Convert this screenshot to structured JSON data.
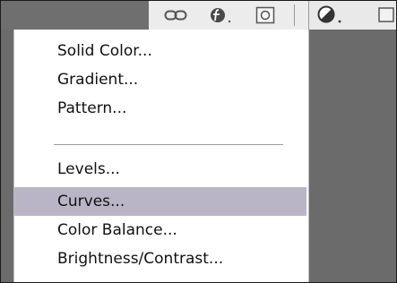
{
  "toolbar": {
    "icons": [
      {
        "name": "link-icon"
      },
      {
        "name": "fx-icon"
      },
      {
        "name": "layer-mask-icon"
      },
      {
        "name": "adjustment-layer-icon"
      },
      {
        "name": "new-layer-icon"
      }
    ]
  },
  "menu": {
    "group1": [
      {
        "label": "Solid Color..."
      },
      {
        "label": "Gradient..."
      },
      {
        "label": "Pattern..."
      }
    ],
    "group2": [
      {
        "label": "Levels..."
      },
      {
        "label": "Curves..."
      },
      {
        "label": "Color Balance..."
      },
      {
        "label": "Brightness/Contrast..."
      }
    ],
    "selected_label": "Curves..."
  },
  "colors": {
    "highlight": "#b9b5c6",
    "frame": "#6b6b6b",
    "menu_bg": "#ffffff"
  }
}
